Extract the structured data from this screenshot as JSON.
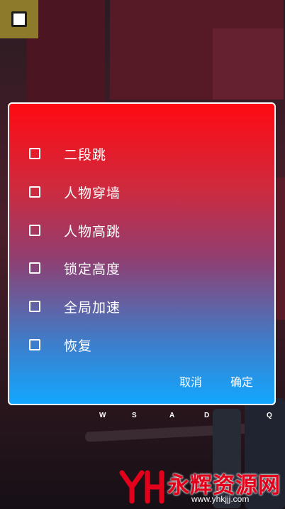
{
  "background": {
    "colors": {
      "dialog_top": "#ff0a12",
      "dialog_bottom": "#12a7ff",
      "toggle_bg": "#8d7a2a"
    }
  },
  "menu_toggle": {
    "icon": "stop-square-icon"
  },
  "dialog": {
    "options": [
      {
        "label": "二段跳",
        "checked": false
      },
      {
        "label": "人物穿墙",
        "checked": false
      },
      {
        "label": "人物高跳",
        "checked": false
      },
      {
        "label": "锁定高度",
        "checked": false
      },
      {
        "label": "全局加速",
        "checked": false
      },
      {
        "label": "恢复",
        "checked": false
      }
    ],
    "cancel_label": "取消",
    "confirm_label": "确定"
  },
  "keys": [
    "W",
    "S",
    "A",
    "D",
    "Q"
  ],
  "watermark": {
    "name": "永辉资源网",
    "url": "www.yhkjjj.com"
  }
}
